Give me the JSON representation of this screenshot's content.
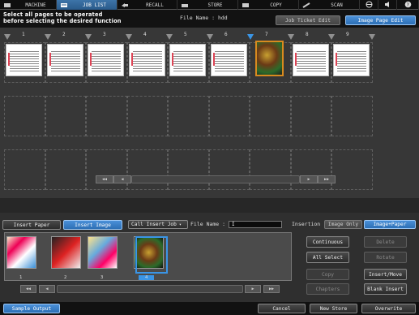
{
  "tabs": [
    {
      "label": "MACHINE",
      "icon": "machine-icon",
      "active": false
    },
    {
      "label": "JOB LIST",
      "icon": "job-list-icon",
      "active": true
    },
    {
      "label": "RECALL",
      "icon": "recall-icon",
      "active": false
    },
    {
      "label": "STORE",
      "icon": "store-icon",
      "active": false
    },
    {
      "label": "COPY",
      "icon": "copy-icon",
      "active": false
    },
    {
      "label": "SCAN",
      "icon": "scan-icon",
      "active": false
    }
  ],
  "header": {
    "instruction_line1": "Select all pages to be operated",
    "instruction_line2": "before selecting the desired function",
    "file_name": "File Name : hdd",
    "job_ticket_edit": "Job Ticket Edit",
    "image_page_edit": "Image Page Edit"
  },
  "page_markers": [
    "1",
    "2",
    "3",
    "4",
    "5",
    "6",
    "7",
    "8",
    "9"
  ],
  "selected_marker": "7",
  "paper_tabs": {
    "insert_paper": "Insert Paper",
    "insert_image": "Insert Image"
  },
  "insert_job": {
    "call_insert_job": "Call Insert Job",
    "file_name_label": "File Name :",
    "file_name_value": "I"
  },
  "insertion": {
    "label": "Insertion",
    "image_only": "Image Only",
    "image_paper": "Image+Paper"
  },
  "thumbs": [
    "1",
    "2",
    "3",
    "4"
  ],
  "selected_thumb": "4",
  "right_buttons": {
    "continuous": "Continuous",
    "delete": "Delete",
    "all_select": "All Select",
    "rotate": "Rotate",
    "copy": "Copy",
    "insert_move": "Insert/Move",
    "chapters": "Chapters",
    "blank_insert": "Blank Insert"
  },
  "footer": {
    "sample_output": "Sample Output",
    "cancel": "Cancel",
    "new_store": "New Store",
    "overwrite": "Overwrite"
  },
  "colors": {
    "accent_blue": "#3a95e6",
    "background": "#272727",
    "selected_page_border": "#d88a1f"
  }
}
